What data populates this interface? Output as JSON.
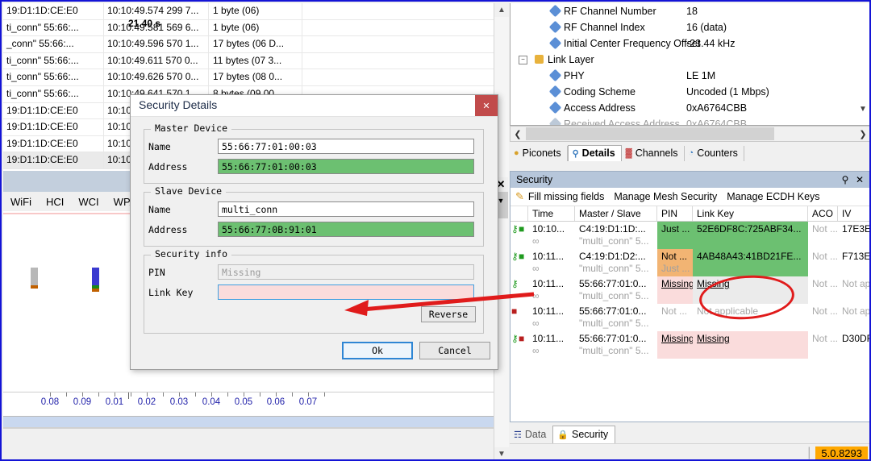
{
  "packet_list": {
    "columns": [
      "address",
      "timestamp",
      "length"
    ],
    "rows": [
      {
        "address": "19:D1:1D:CE:E0",
        "timestamp": "10:10:49.574 299 7...",
        "length": "1 byte (06)",
        "selected": false
      },
      {
        "address": "ti_conn\" 55:66:...",
        "timestamp": "10:10:49.581 569 6...",
        "length": "1 byte (06)",
        "selected": false
      },
      {
        "address": "_conn\" 55:66:...",
        "timestamp": "10:10:49.596 570 1...",
        "length": "17 bytes (06 D...",
        "selected": false
      },
      {
        "address": "ti_conn\" 55:66:...",
        "timestamp": "10:10:49.611 570 0...",
        "length": "11 bytes (07 3...",
        "selected": false
      },
      {
        "address": "ti_conn\" 55:66:...",
        "timestamp": "10:10:49.626 570 0...",
        "length": "17 bytes (08 0...",
        "selected": false
      },
      {
        "address": "ti_conn\" 55:66:...",
        "timestamp": "10:10:49.641 570 1...",
        "length": "8 bytes (09 00...",
        "selected": false
      },
      {
        "address": "19:D1:1D:CE:E0",
        "timestamp": "10:10:49...",
        "length": "",
        "selected": false
      },
      {
        "address": "19:D1:1D:CE:E0",
        "timestamp": "10:10:49...",
        "length": "",
        "selected": false
      },
      {
        "address": "19:D1:1D:CE:E0",
        "timestamp": "10:10:49...",
        "length": "",
        "selected": false
      },
      {
        "address": "19:D1:1D:CE:E0",
        "timestamp": "10:10:49...",
        "length": "",
        "selected": true
      }
    ]
  },
  "protocol_tabs": [
    {
      "label": "WiFi",
      "active": false
    },
    {
      "label": "HCI",
      "active": false
    },
    {
      "label": "WCI",
      "active": false
    },
    {
      "label": "WPAN",
      "active": false
    },
    {
      "label": "",
      "active": true
    }
  ],
  "timeline": {
    "center_label": "21.40  s",
    "tick_labels": [
      "0.08",
      "0.09",
      "0.01",
      "0.02",
      "0.03",
      "0.04",
      "0.05",
      "0.06",
      "0.07"
    ],
    "tick_x": [
      58,
      98,
      138,
      178,
      218,
      258,
      298,
      338,
      378
    ]
  },
  "dialog": {
    "title": "Security Details",
    "close_icon": "close-icon",
    "master_device": {
      "legend": "Master Device",
      "name_label": "Name",
      "name_value": "55:66:77:01:00:03",
      "address_label": "Address",
      "address_value": "55:66:77:01:00:03"
    },
    "slave_device": {
      "legend": "Slave Device",
      "name_label": "Name",
      "name_value": "multi_conn",
      "address_label": "Address",
      "address_value": "55:66:77:0B:91:01"
    },
    "security_info": {
      "legend": "Security info",
      "pin_label": "PIN",
      "pin_placeholder": "Missing",
      "pin_value": "",
      "link_key_label": "Link Key",
      "link_key_value": "",
      "reverse_label": "Reverse"
    },
    "ok_label": "Ok",
    "cancel_label": "Cancel"
  },
  "details_tree": {
    "rows": [
      {
        "indent": 2,
        "icon": "diamond-icon",
        "label": "RF Channel Number",
        "value": "18",
        "dim": false,
        "expander": null
      },
      {
        "indent": 2,
        "icon": "diamond-icon",
        "label": "RF Channel Index",
        "value": "16 (data)",
        "dim": false,
        "expander": null
      },
      {
        "indent": 2,
        "icon": "diamond-icon",
        "label": "Initial Center Frequency Offset",
        "value": "-23.44 kHz",
        "dim": false,
        "expander": null
      },
      {
        "indent": 1,
        "icon": "link-layer-icon",
        "label": "Link Layer",
        "value": "",
        "dim": false,
        "expander": "minus"
      },
      {
        "indent": 2,
        "icon": "diamond-icon",
        "label": "PHY",
        "value": "LE 1M",
        "dim": false,
        "expander": null
      },
      {
        "indent": 2,
        "icon": "diamond-icon",
        "label": "Coding Scheme",
        "value": "Uncoded (1 Mbps)",
        "dim": false,
        "expander": null
      },
      {
        "indent": 2,
        "icon": "diamond-icon",
        "label": "Access Address",
        "value": "0xA6764CBB",
        "dim": false,
        "expander": null
      },
      {
        "indent": 2,
        "icon": "diamond-icon",
        "label": "Received Access Address",
        "value": "0xA6764CBB",
        "dim": true,
        "expander": null
      }
    ]
  },
  "view_tabs": [
    {
      "label": "Piconets",
      "icon": "piconets-icon",
      "active": false
    },
    {
      "label": "Details",
      "icon": "magnifier-icon",
      "active": true
    },
    {
      "label": "Channels",
      "icon": "channels-icon",
      "active": false
    },
    {
      "label": "Counters",
      "icon": "counters-icon",
      "active": false
    }
  ],
  "security_panel": {
    "title": "Security",
    "pin_icon": "pin-icon",
    "close_icon": "close-icon",
    "toolbar": [
      {
        "label": "Fill missing fields",
        "icon": "pencil-icon"
      },
      {
        "label": "Manage Mesh Security",
        "icon": null
      },
      {
        "label": "Manage ECDH Keys",
        "icon": null
      }
    ],
    "columns": [
      "",
      "Time",
      "Master / Slave",
      "PIN",
      "Link Key",
      "ACO",
      "IV"
    ],
    "rows": [
      {
        "icon": "key-green-lock-green-icon",
        "time_top": "10:10...",
        "time_bot": "∞",
        "ms_top": "C4:19:D1:1D:...",
        "ms_bot": "\"multi_conn\" 5...",
        "pin_top": "Just ...",
        "pin_bot": "",
        "pin_bg": "green",
        "pin_dim": false,
        "pin_ul": false,
        "lk": "52E6DF8C:725ABF34...",
        "lk_bg": "green",
        "lk_dim": false,
        "lk_ul": false,
        "aco": "Not ...",
        "aco_dim": true,
        "iv": "17E3E...",
        "iv_dim": false,
        "row_bg": "white"
      },
      {
        "icon": "key-green-lock-green-icon",
        "time_top": "10:11...",
        "time_bot": "∞",
        "ms_top": "C4:19:D1:D2:...",
        "ms_bot": "\"multi_conn\" 5...",
        "pin_top": "Not ...",
        "pin_bot": "Just ...",
        "pin_bg": "orange",
        "pin_dim": false,
        "pin_ul": false,
        "lk": "4AB48A43:41BD21FE...",
        "lk_bg": "green",
        "lk_dim": false,
        "lk_ul": false,
        "aco": "Not ...",
        "aco_dim": true,
        "iv": "F713E7...",
        "iv_dim": false,
        "row_bg": "white"
      },
      {
        "icon": "key-green-icon",
        "time_top": "10:11...",
        "time_bot": "∞",
        "ms_top": "55:66:77:01:0...",
        "ms_bot": "\"multi_conn\" 5...",
        "pin_top": "Missing",
        "pin_bot": "",
        "pin_bg": "pink",
        "pin_dim": false,
        "pin_ul": true,
        "lk": "Missing",
        "lk_bg": "gray",
        "lk_dim": false,
        "lk_ul": true,
        "aco": "Not ...",
        "aco_dim": true,
        "iv": "Not ap...",
        "iv_dim": true,
        "row_bg": "white"
      },
      {
        "icon": "lock-red-icon",
        "time_top": "10:11...",
        "time_bot": "∞",
        "ms_top": "55:66:77:01:0...",
        "ms_bot": "\"multi_conn\" 5...",
        "pin_top": "Not ...",
        "pin_bot": "",
        "pin_bg": "white",
        "pin_dim": true,
        "pin_ul": false,
        "lk": "Not applicable",
        "lk_bg": "white",
        "lk_dim": true,
        "lk_ul": false,
        "aco": "Not ...",
        "aco_dim": true,
        "iv": "Not ap...",
        "iv_dim": true,
        "row_bg": "white"
      },
      {
        "icon": "key-green-lock-red-icon",
        "time_top": "10:11...",
        "time_bot": "∞",
        "ms_top": "55:66:77:01:0...",
        "ms_bot": "\"multi_conn\" 5...",
        "pin_top": "Missing",
        "pin_bot": "",
        "pin_bg": "pink",
        "pin_dim": false,
        "pin_ul": true,
        "lk": "Missing",
        "lk_bg": "pink",
        "lk_dim": false,
        "lk_ul": true,
        "aco": "Not ...",
        "aco_dim": true,
        "iv": "D30DF...",
        "iv_dim": false,
        "row_bg": "white"
      }
    ]
  },
  "bottom_tabs": [
    {
      "label": "Data",
      "icon": "binary-icon",
      "active": false
    },
    {
      "label": "Security",
      "icon": "lock-icon",
      "active": true
    }
  ],
  "status": {
    "version": "5.0.8293"
  },
  "colors": {
    "window_border": "#1414d6",
    "green_ok": "#6cc071",
    "orange_warn": "#f2b473",
    "pink_missing": "#fadcdc",
    "annotation_red": "#e01b1b",
    "version_badge": "#ffa800",
    "panel_title": "#b6c6da",
    "dialog_close": "#c14b4b"
  }
}
